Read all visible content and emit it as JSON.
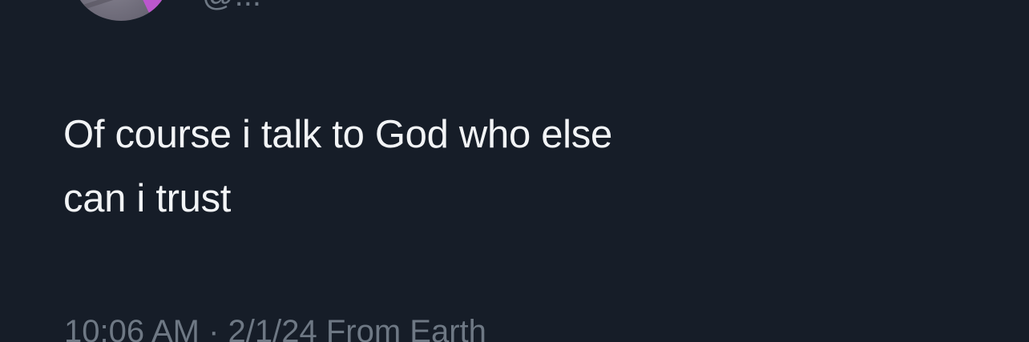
{
  "tweet": {
    "author_handle": "@...",
    "text_lines": [
      "Of course i talk to God who else",
      "can i trust"
    ],
    "timestamp": "10:06 AM · 2/1/24 From Earth"
  },
  "colors": {
    "background": "#161d28",
    "text_primary": "#f2f4f6",
    "text_secondary": "#6e7884",
    "avatar_accent": "#c455d6"
  }
}
